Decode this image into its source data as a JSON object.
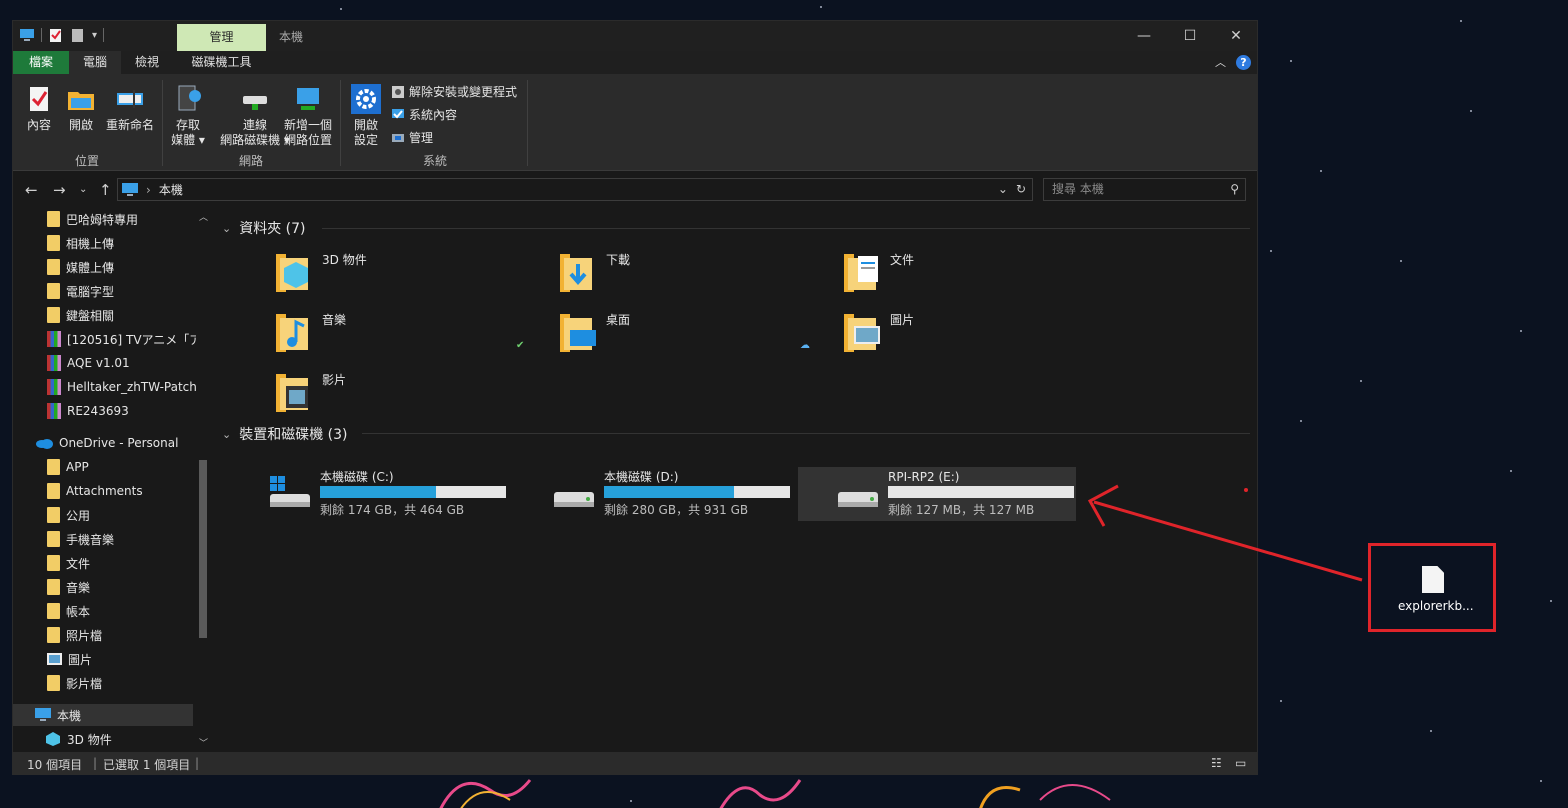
{
  "window": {
    "title": "本機",
    "context_tab": "管理",
    "controls": {
      "minimize": "—",
      "maximize": "☐",
      "close": "✕"
    }
  },
  "ribbon_tabs": [
    "檔案",
    "電腦",
    "檢視",
    "磁碟機工具"
  ],
  "ribbon": {
    "location": {
      "buttons": [
        "內容",
        "開啟",
        "重新命名"
      ],
      "label": "位置"
    },
    "network": {
      "buttons": [
        {
          "line1": "存取",
          "line2": "媒體 ▾"
        },
        {
          "line1": "連線",
          "line2": "網路磁碟機 ▾"
        },
        {
          "line1": "新增一個",
          "line2": "網路位置"
        }
      ],
      "label": "網路"
    },
    "system": {
      "open_settings": {
        "line1": "開啟",
        "line2": "設定"
      },
      "small": [
        "解除安裝或變更程式",
        "系統內容",
        "管理"
      ],
      "label": "系統"
    }
  },
  "address": {
    "path": "本機",
    "separator": "›"
  },
  "search": {
    "placeholder": "搜尋 本機"
  },
  "sidebar": {
    "items": [
      {
        "label": "巴哈姆特專用",
        "icon": "folder-icon"
      },
      {
        "label": "相機上傳",
        "icon": "folder-icon"
      },
      {
        "label": "媒體上傳",
        "icon": "folder-icon"
      },
      {
        "label": "電腦字型",
        "icon": "folder-icon"
      },
      {
        "label": "鍵盤相關",
        "icon": "folder-icon"
      },
      {
        "label": "[120516] TVアニメ「ア",
        "icon": "archive-icon"
      },
      {
        "label": "AQE v1.01",
        "icon": "archive-icon"
      },
      {
        "label": "Helltaker_zhTW-Patch_",
        "icon": "archive-icon"
      },
      {
        "label": "RE243693",
        "icon": "archive-icon"
      },
      {
        "label": "OneDrive - Personal",
        "icon": "onedrive-icon"
      },
      {
        "label": "APP",
        "icon": "folder-icon"
      },
      {
        "label": "Attachments",
        "icon": "folder-icon"
      },
      {
        "label": "公用",
        "icon": "folder-icon"
      },
      {
        "label": "手機音樂",
        "icon": "folder-icon"
      },
      {
        "label": "文件",
        "icon": "folder-icon"
      },
      {
        "label": "音樂",
        "icon": "folder-icon"
      },
      {
        "label": "帳本",
        "icon": "folder-icon"
      },
      {
        "label": "照片檔",
        "icon": "folder-icon"
      },
      {
        "label": "圖片",
        "icon": "pictures-icon"
      },
      {
        "label": "影片檔",
        "icon": "folder-icon"
      },
      {
        "label": "本機",
        "icon": "this-pc-icon"
      },
      {
        "label": "3D 物件",
        "icon": "3d-objects-icon"
      }
    ]
  },
  "folders_section": {
    "title": "資料夾 (7)",
    "items": [
      {
        "name": "3D 物件",
        "icon": "3d-objects-folder-icon"
      },
      {
        "name": "下載",
        "icon": "downloads-folder-icon"
      },
      {
        "name": "文件",
        "icon": "documents-folder-icon"
      },
      {
        "name": "音樂",
        "icon": "music-folder-icon"
      },
      {
        "name": "桌面",
        "icon": "desktop-folder-icon"
      },
      {
        "name": "圖片",
        "icon": "pictures-folder-icon"
      },
      {
        "name": "影片",
        "icon": "videos-folder-icon"
      }
    ]
  },
  "devices_section": {
    "title": "裝置和磁碟機 (3)",
    "drives": [
      {
        "name": "本機磁碟 (C:)",
        "free": "剩餘 174 GB，共 464 GB",
        "used_fraction": 0.625,
        "icon": "windows-drive-icon"
      },
      {
        "name": "本機磁碟 (D:)",
        "free": "剩餘 280 GB，共 931 GB",
        "used_fraction": 0.7,
        "icon": "drive-icon"
      },
      {
        "name": "RPI-RP2 (E:)",
        "free": "剩餘 127 MB，共 127 MB",
        "used_fraction": 0.0,
        "icon": "drive-icon"
      }
    ]
  },
  "status": {
    "count": "10 個項目",
    "selected": "已選取 1 個項目"
  },
  "desktop": {
    "file_label": "explorerkb..."
  },
  "colors": {
    "accent": "#26a0da",
    "file_tab": "#1e7a3a",
    "context_tab": "#cfe8b5",
    "annotation": "#e0242a"
  }
}
